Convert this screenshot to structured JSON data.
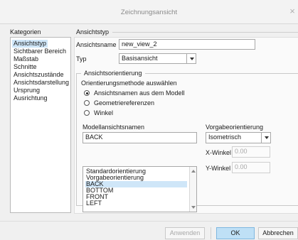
{
  "window": {
    "title": "Zeichnungsansicht",
    "close_glyph": "×"
  },
  "sidebar": {
    "heading": "Kategorien",
    "items": [
      {
        "label": "Ansichtstyp",
        "selected": true
      },
      {
        "label": "Sichtbarer Bereich"
      },
      {
        "label": "Maßstab"
      },
      {
        "label": "Schnitte"
      },
      {
        "label": "Ansichtszustände"
      },
      {
        "label": "Ansichtsdarstellung"
      },
      {
        "label": "Ursprung"
      },
      {
        "label": "Ausrichtung"
      }
    ]
  },
  "main": {
    "section_heading": "Ansichtstyp",
    "view_name_label": "Ansichtsname",
    "view_name_value": "new_view_2",
    "type_label": "Typ",
    "type_value": "Basisansicht",
    "orientation": {
      "group_title": "Ansichtsorientierung",
      "method_label": "Orientierungsmethode auswählen",
      "options": [
        {
          "label": "Ansichtsnamen aus dem Modell",
          "checked": true
        },
        {
          "label": "Geometriereferenzen",
          "checked": false
        },
        {
          "label": "Winkel",
          "checked": false
        }
      ],
      "model_views_label": "Modellansichtsnamen",
      "model_view_value": "BACK",
      "model_views": [
        {
          "label": "Standardorientierung"
        },
        {
          "label": "Vorgabeorientierung"
        },
        {
          "label": "BACK",
          "selected": true
        },
        {
          "label": "BOTTOM"
        },
        {
          "label": "FRONT"
        },
        {
          "label": "LEFT"
        }
      ],
      "default_orientation_label": "Vorgabeorientierung",
      "default_orientation_value": "Isometrisch",
      "x_angle_label": "X-Winkel",
      "x_angle_value": "0.00",
      "y_angle_label": "Y-Winkel",
      "y_angle_value": "0.00"
    }
  },
  "buttons": {
    "apply": "Anwenden",
    "ok": "OK",
    "cancel": "Abbrechen"
  }
}
